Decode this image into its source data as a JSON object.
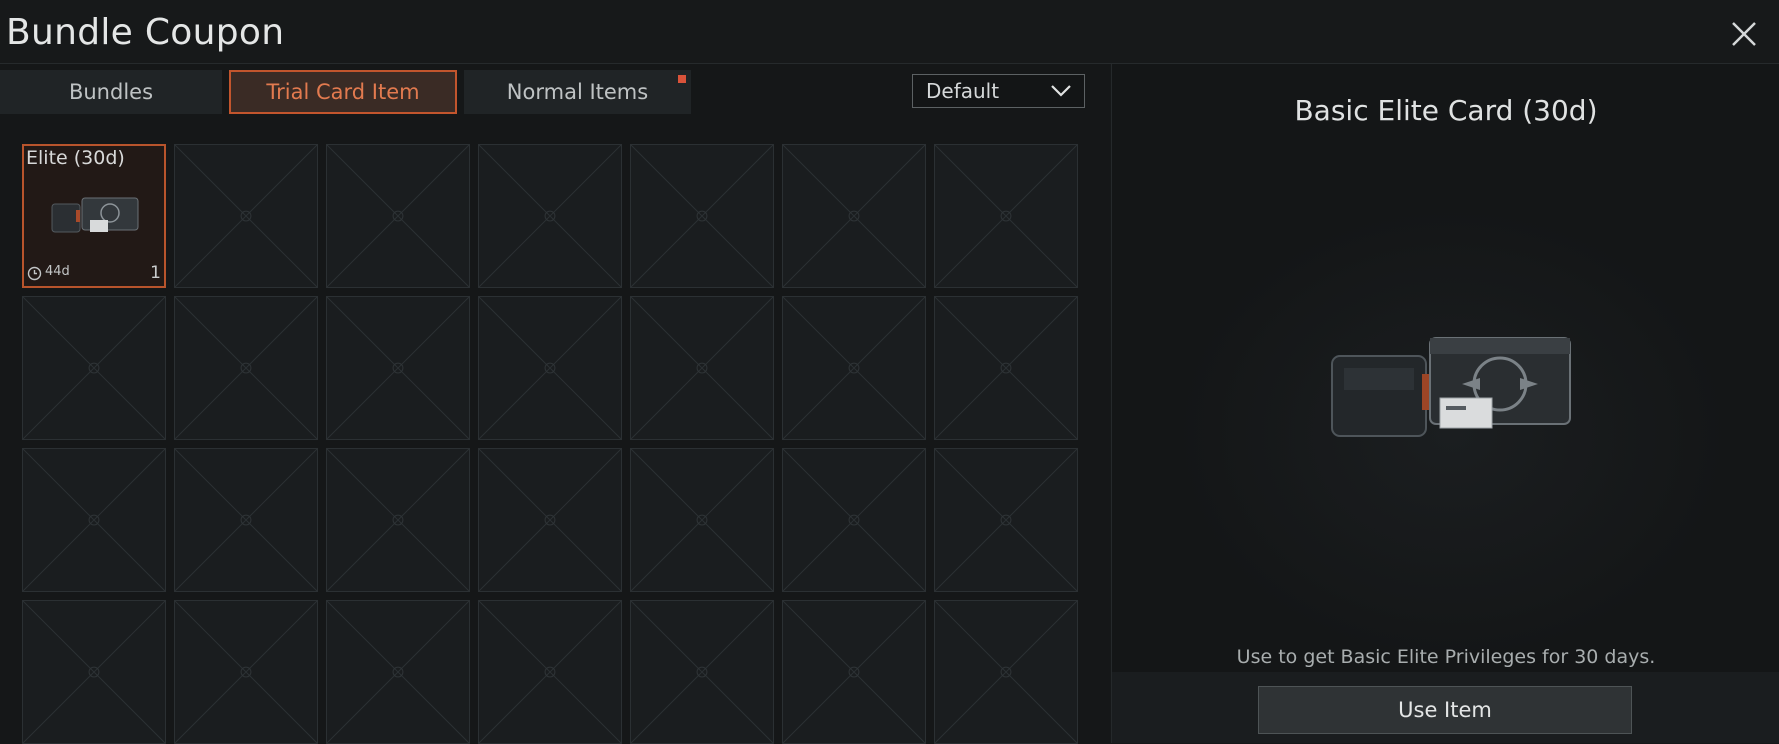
{
  "window": {
    "title": "Bundle Coupon"
  },
  "tabs": [
    {
      "label": "Bundles"
    },
    {
      "label": "Trial Card Item"
    },
    {
      "label": "Normal Items"
    }
  ],
  "sort": {
    "selected": "Default"
  },
  "items": [
    {
      "title": "Elite (30d)",
      "time": "44d",
      "qty": "1"
    }
  ],
  "detail": {
    "title": "Basic Elite Card (30d)",
    "description": "Use to get Basic Elite Privileges for 30 days.",
    "use_button": "Use Item"
  },
  "colors": {
    "accent": "#c2552d",
    "accent_text": "#e27a4f",
    "notify": "#d9533a"
  }
}
